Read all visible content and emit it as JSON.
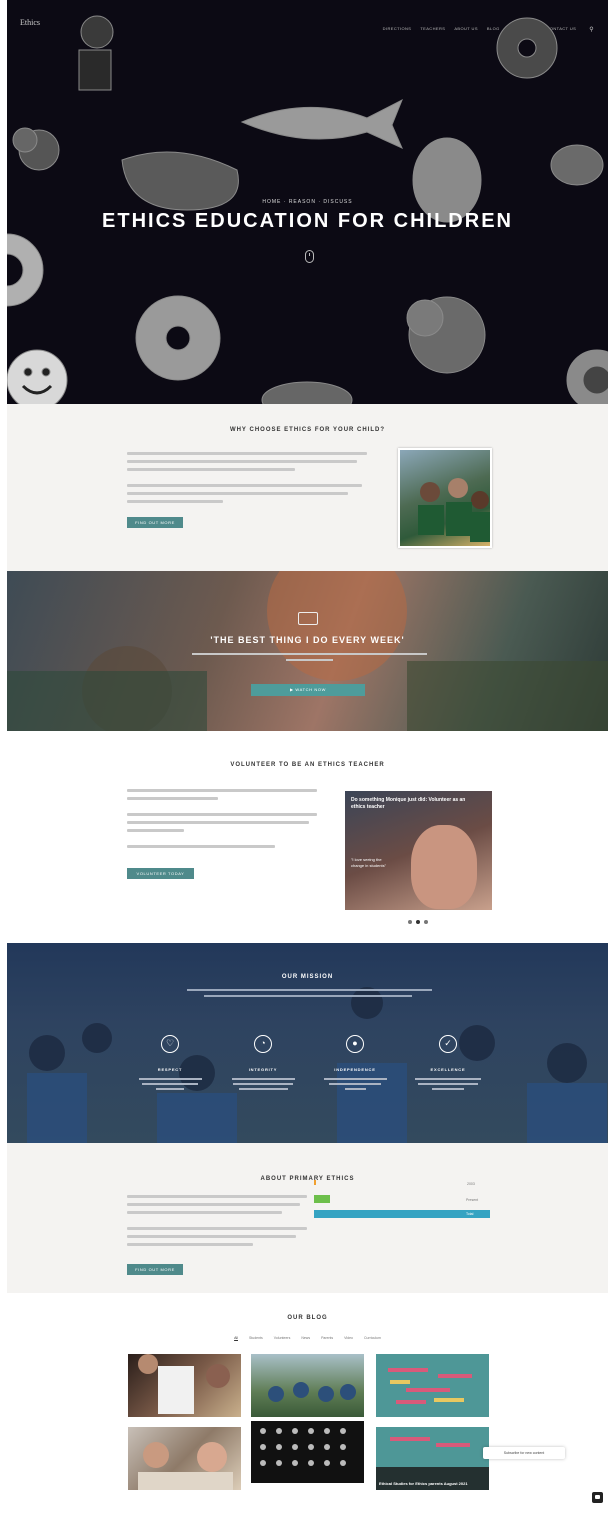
{
  "header": {
    "logo": "Ethics",
    "nav": [
      "DIRECTIONS",
      "TEACHERS",
      "ABOUT US",
      "BLOG",
      "RESOURCES",
      "CONTACT US"
    ],
    "search_icon": "search-icon"
  },
  "hero": {
    "breadcrumb": "HOME · REASON · DISCUSS",
    "title": "ETHICS EDUCATION FOR CHILDREN",
    "scroll_icon": "mouse-icon"
  },
  "why": {
    "title": "WHY CHOOSE ETHICS FOR YOUR CHILD?",
    "button": "FIND OUT MORE"
  },
  "video": {
    "icon": "video-camera-icon",
    "quote": "'THE BEST THING I DO EVERY WEEK'",
    "button": "▶ WATCH NOW"
  },
  "volunteer": {
    "title": "VOLUNTEER TO BE AN ETHICS TEACHER",
    "button": "VOLUNTEER TODAY",
    "card_caption": "Do something Monique just did: Volunteer as an ethics teacher",
    "card_side": "\"I love seeing the change in students\""
  },
  "mission": {
    "title": "OUR MISSION",
    "values": [
      {
        "label": "RESPECT",
        "icon": "heart-icon"
      },
      {
        "label": "INTEGRITY",
        "icon": "clock-icon"
      },
      {
        "label": "INDEPENDENCE",
        "icon": "person-icon"
      },
      {
        "label": "EXCELLENCE",
        "icon": "check-circle-icon"
      }
    ]
  },
  "about": {
    "title": "ABOUT PRIMARY ETHICS",
    "button": "FIND OUT MORE",
    "bars": [
      {
        "label": "2003",
        "value": 0.01,
        "color": "#f0a030"
      },
      {
        "label": "Present",
        "value": 0.08,
        "color": "#6dbf4b"
      },
      {
        "label": "Total",
        "value": 1.0,
        "color": "#35a3c2"
      }
    ]
  },
  "blog": {
    "title": "OUR BLOG",
    "filters": [
      "All",
      "Students",
      "Volunteers",
      "News",
      "Parents",
      "Video",
      "Curriculum"
    ],
    "posts": [
      {
        "title": ""
      },
      {
        "title": ""
      },
      {
        "title": ""
      },
      {
        "title": ""
      },
      {
        "title": ""
      },
      {
        "title": "Ethical Studies for Ethics parents August 2021"
      }
    ],
    "tooltip": "Subscribe for new content"
  }
}
